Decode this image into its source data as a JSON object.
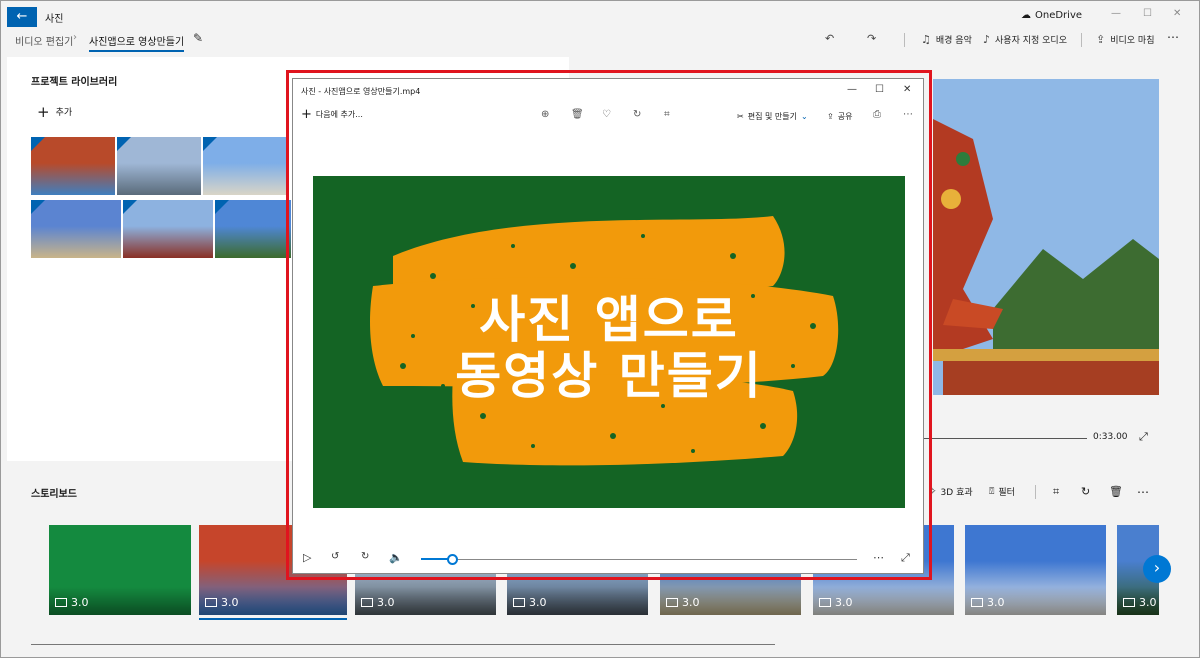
{
  "app": {
    "back_label": "←",
    "title": "사진",
    "onedrive": "OneDrive"
  },
  "window_controls": {
    "minimize": "—",
    "maximize": "☐",
    "close": "✕"
  },
  "breadcrumb": {
    "parent": "비디오 편집기",
    "current": "사진앱으로 영상만들기"
  },
  "commands": {
    "bg_music": "배경 음악",
    "custom_audio": "사용자 지정 오디오",
    "finish_video": "비디오 마침",
    "more": "⋯"
  },
  "library": {
    "title": "프로젝트 라이브러리",
    "add_label": "추가",
    "thumbnails": [
      {
        "colors": [
          "#b84a2a",
          "#3f7fbf"
        ]
      },
      {
        "colors": [
          "#9fb7d6",
          "#5a6b7a"
        ]
      },
      {
        "colors": [
          "#7eaee8",
          "#d9d5c7"
        ]
      },
      {
        "colors": [
          "#5b84d1",
          "#c9b489"
        ]
      },
      {
        "colors": [
          "#8db2e0",
          "#8a2f24"
        ]
      },
      {
        "colors": [
          "#4f87d6",
          "#3c6b2c"
        ]
      }
    ]
  },
  "preview": {
    "time": "0:33.00"
  },
  "storyboard": {
    "title": "스토리보드",
    "tools": {
      "effects_3d": "3D 효과",
      "filter": "필터"
    },
    "clips": [
      {
        "duration": "3.0",
        "colors": [
          "#148a3f",
          "#148a3f"
        ]
      },
      {
        "duration": "3.0",
        "colors": [
          "#c6452b",
          "#3a7ed0"
        ]
      },
      {
        "duration": "3.0",
        "colors": [
          "#a9bfd8",
          "#555f66"
        ]
      },
      {
        "duration": "3.0",
        "colors": [
          "#90b3dc",
          "#4a5560"
        ]
      },
      {
        "duration": "3.0",
        "colors": [
          "#3e77d1",
          "#c9b98d"
        ]
      },
      {
        "duration": "3.0",
        "colors": [
          "#3e77d1",
          "#e6e6e0"
        ]
      },
      {
        "duration": "3.0",
        "colors": [
          "#3e77d1",
          "#eeeeea"
        ]
      },
      {
        "duration": "3.0",
        "colors": [
          "#4a7fcf",
          "#2d5a2a"
        ]
      }
    ]
  },
  "viewer": {
    "title": "사진 - 사진앱으로 영상만들기.mp4",
    "add_to": "다음에 추가...",
    "edit_create": "편집 및 만들기",
    "share": "공유",
    "more": "⋯",
    "video_line1": "사진 앱으로",
    "video_line2": "동영상 만들기",
    "seek_fraction": 0.07
  },
  "colors": {
    "accent": "#0063b1",
    "video_bg": "#146424",
    "brush": "#f29a0b",
    "highlight": "#e0141e"
  }
}
